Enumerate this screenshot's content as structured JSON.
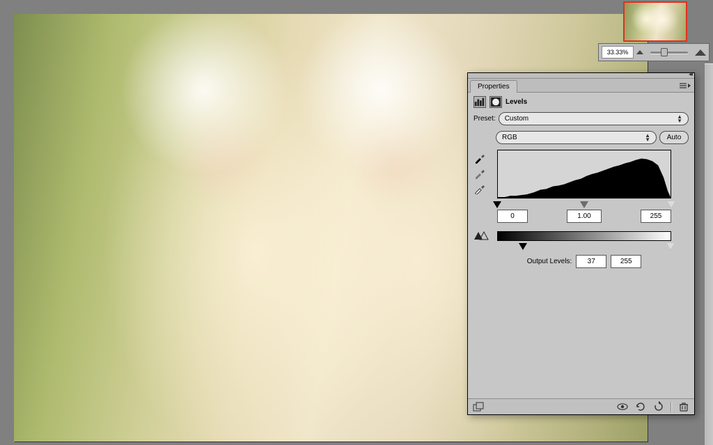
{
  "navigator": {
    "zoom_percent": "33.33%"
  },
  "panel": {
    "tab": "Properties",
    "title": "Levels",
    "preset_label": "Preset:",
    "preset_value": "Custom",
    "channel_value": "RGB",
    "auto_label": "Auto",
    "input_shadows": "0",
    "input_mid": "1.00",
    "input_highlights": "255",
    "output_label": "Output Levels:",
    "output_shadows": "37",
    "output_highlights": "255"
  }
}
